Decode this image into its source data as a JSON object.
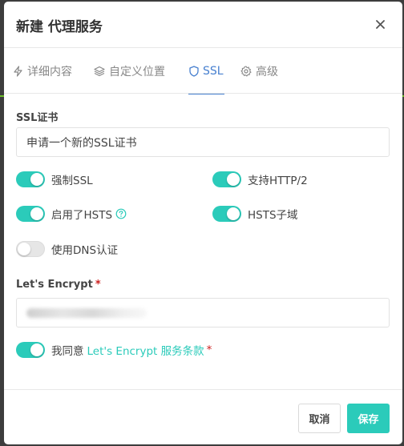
{
  "modal": {
    "title": "新建 代理服务"
  },
  "tabs": [
    {
      "label": "详细内容",
      "icon": "bolt-icon"
    },
    {
      "label": "自定义位置",
      "icon": "layers-icon"
    },
    {
      "label": "SSL",
      "icon": "shield-icon",
      "active": true
    },
    {
      "label": "高级",
      "icon": "gear-icon"
    }
  ],
  "ssl": {
    "cert_label": "SSL证书",
    "cert_value": "申请一个新的SSL证书",
    "toggles": {
      "force_ssl": {
        "label": "强制SSL",
        "on": true
      },
      "http2": {
        "label": "支持HTTP/2",
        "on": true
      },
      "hsts": {
        "label": "启用了HSTS",
        "on": true
      },
      "hsts_subdomains": {
        "label": "HSTS子域",
        "on": true
      },
      "dns_challenge": {
        "label": "使用DNS认证",
        "on": false
      },
      "agree": {
        "label": "我同意",
        "on": true
      }
    },
    "agree_link": "Let's Encrypt 服务条款",
    "agree_required": "*",
    "letsencrypt_label": "Let's Encrypt",
    "letsencrypt_required": "*"
  },
  "footer": {
    "cancel_label": "取消",
    "save_label": "保存"
  },
  "colors": {
    "accent": "#2bcbba",
    "tab_active": "#467fcf",
    "required": "#cd201f"
  }
}
